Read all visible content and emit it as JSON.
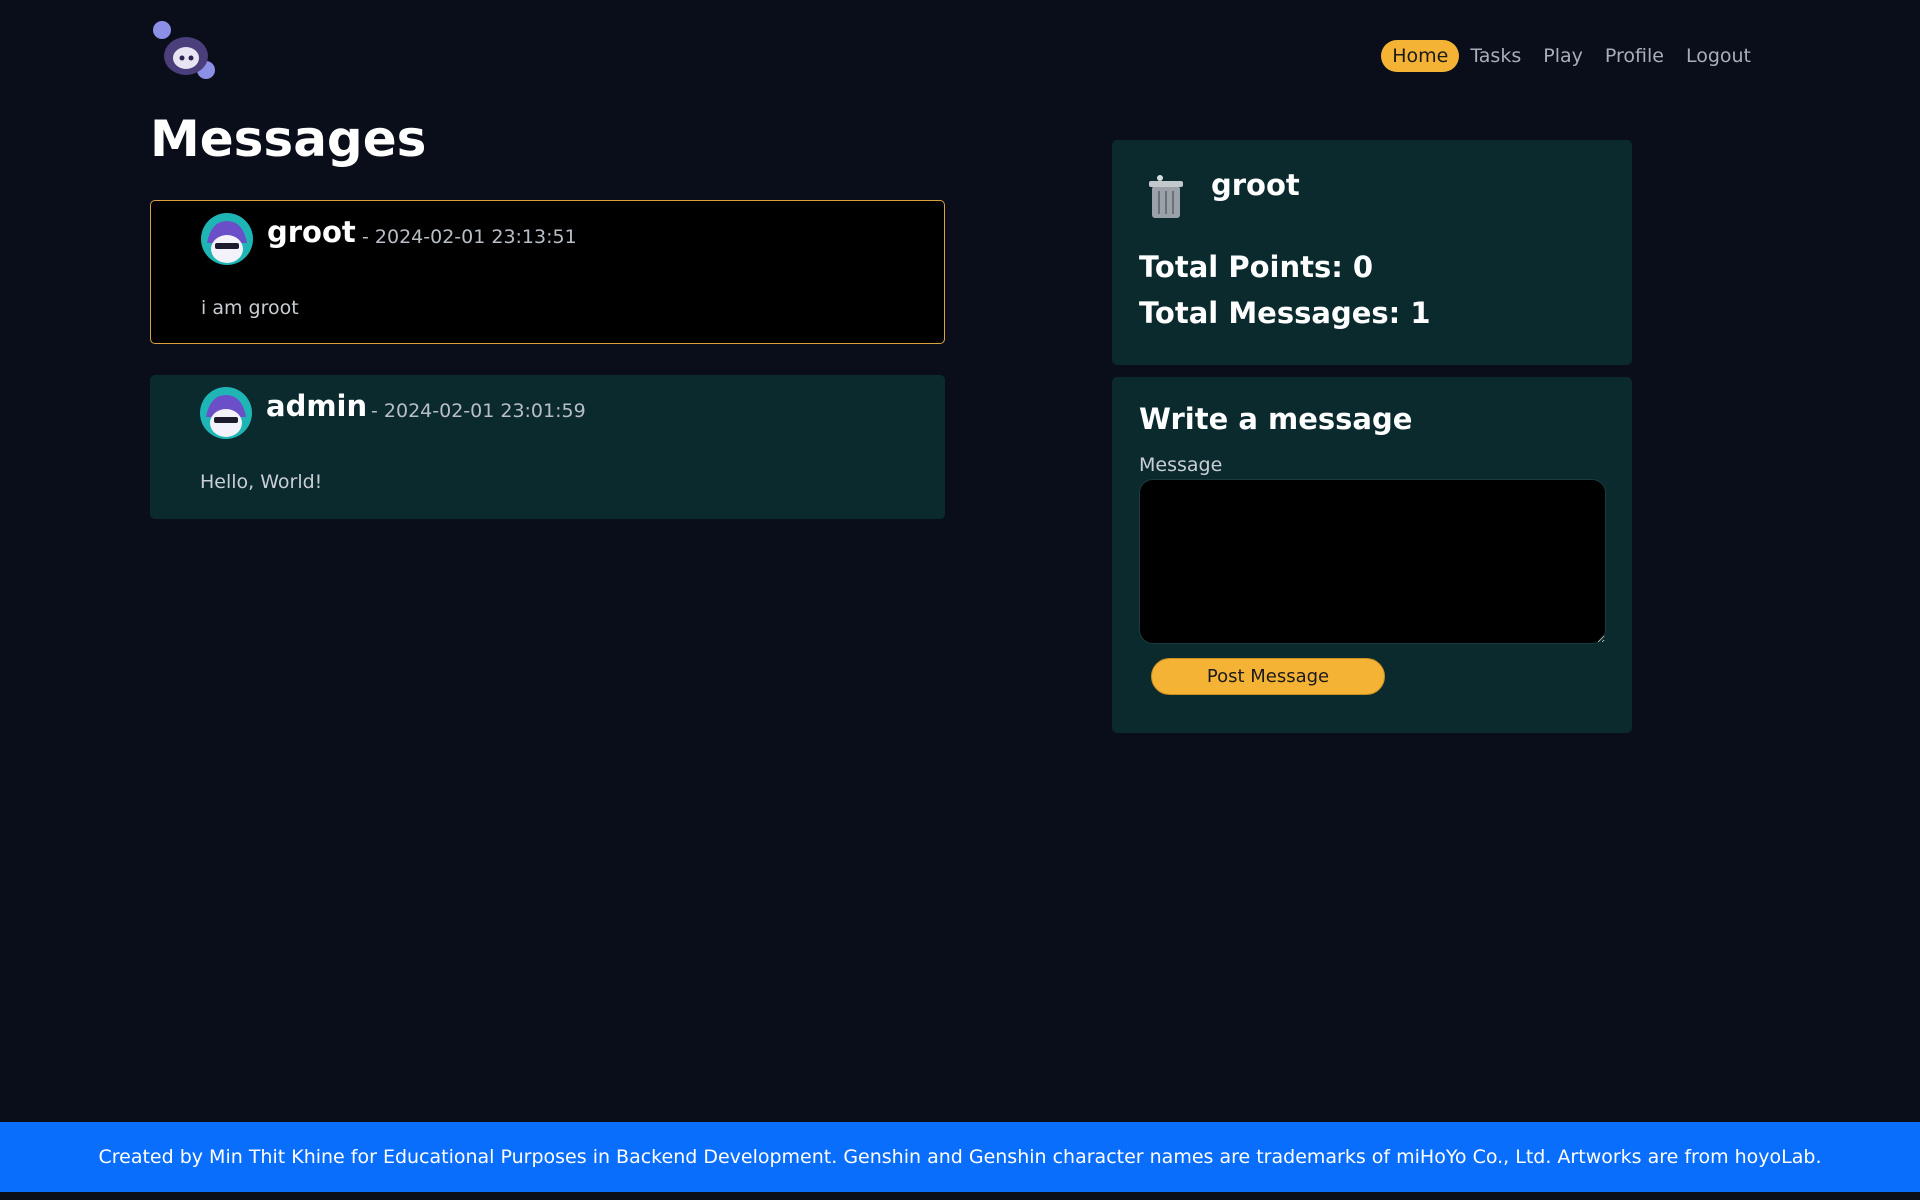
{
  "nav": {
    "items": [
      {
        "label": "Home",
        "active": true
      },
      {
        "label": "Tasks",
        "active": false
      },
      {
        "label": "Play",
        "active": false
      },
      {
        "label": "Profile",
        "active": false
      },
      {
        "label": "Logout",
        "active": false
      }
    ]
  },
  "page": {
    "title": "Messages"
  },
  "messages": [
    {
      "user": "groot",
      "time": "- 2024-02-01 23:13:51",
      "text": "i am groot",
      "own": true
    },
    {
      "user": "admin",
      "time": "- 2024-02-01 23:01:59",
      "text": "Hello, World!",
      "own": false
    }
  ],
  "profile": {
    "name": "groot",
    "points_label": "Total Points: 0",
    "messages_label": "Total Messages: 1"
  },
  "compose": {
    "title": "Write a message",
    "field_label": "Message",
    "value": "",
    "button_label": "Post Message"
  },
  "footer": {
    "text": "Created by Min Thit Khine for Educational Purposes in Backend Development. Genshin and Genshin character names are trademarks of miHoYo Co., Ltd. Artworks are from hoyoLab."
  },
  "colors": {
    "background": "#0a0e1a",
    "card": "#0b2a2e",
    "accent": "#f5b335",
    "footer": "#0a6efd"
  }
}
